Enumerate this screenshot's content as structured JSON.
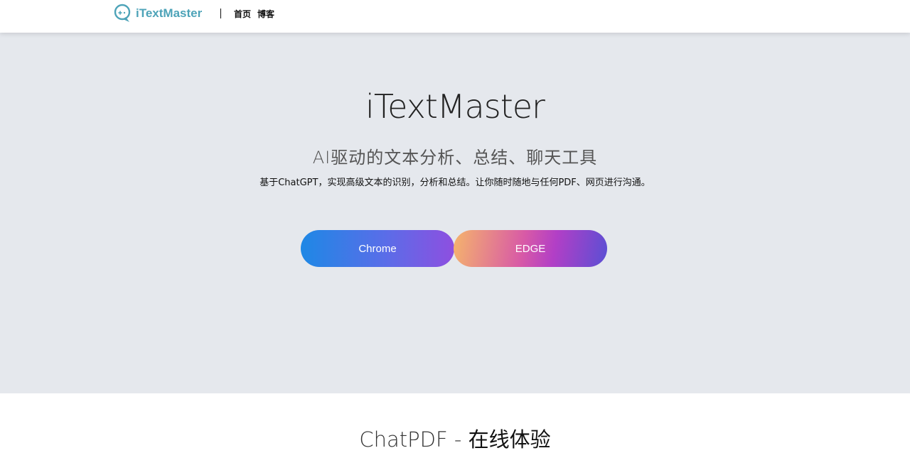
{
  "header": {
    "logo_text": "iTextMaster",
    "logo_icon": "chat-bubble-icon",
    "nav": [
      {
        "label": "首页"
      },
      {
        "label": "博客"
      }
    ]
  },
  "hero": {
    "title": "iTextMaster",
    "subtitle": "AI驱动的文本分析、总结、聊天工具",
    "description": "基于ChatGPT，实现高级文本的识别，分析和总结。让你随时随地与任何PDF、网页进行沟通。",
    "buttons": {
      "chrome_label": "Chrome",
      "edge_label": "EDGE"
    }
  },
  "section2": {
    "title_light": "ChatPDF - ",
    "title_bold": "在线体验"
  },
  "colors": {
    "brand": "#4da3b8",
    "hero_bg": "#e5e8ed",
    "chrome_gradient_start": "#1e88e5",
    "chrome_gradient_end": "#8e4fe0",
    "edge_gradient_start": "#f5b46c",
    "edge_gradient_end": "#5a4fd4"
  }
}
